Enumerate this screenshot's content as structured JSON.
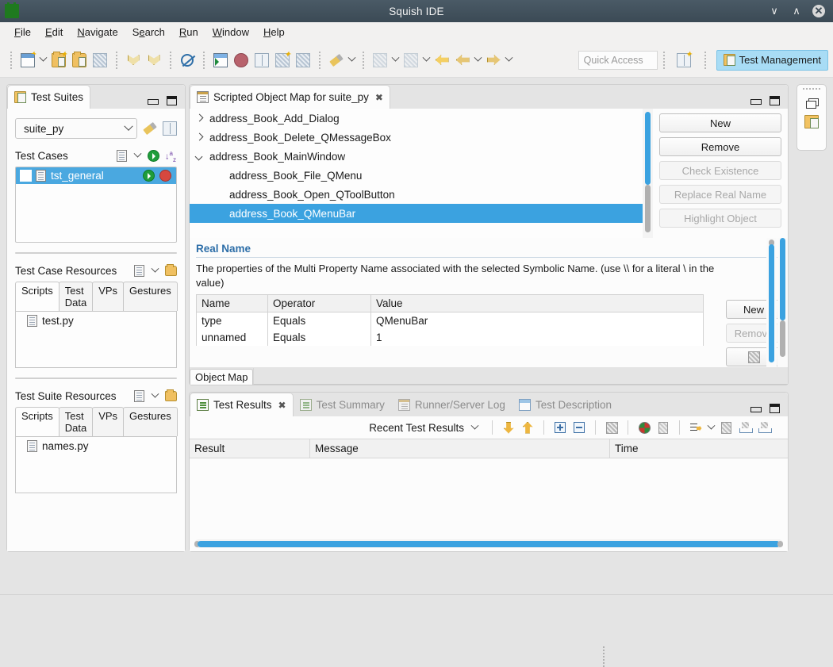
{
  "window": {
    "title": "Squish IDE",
    "logo_icon": "squish-logo-icon",
    "minimize_label": "∨",
    "maximize_label": "∧",
    "close_label": "✕"
  },
  "menubar": {
    "items": [
      {
        "label": "File",
        "mnemonic": "F"
      },
      {
        "label": "Edit",
        "mnemonic": "E"
      },
      {
        "label": "Navigate",
        "mnemonic": "N"
      },
      {
        "label": "Search",
        "mnemonic": "e"
      },
      {
        "label": "Run",
        "mnemonic": "R"
      },
      {
        "label": "Window",
        "mnemonic": "W"
      },
      {
        "label": "Help",
        "mnemonic": "H"
      }
    ]
  },
  "toolbar": {
    "quick_access_placeholder": "Quick Access",
    "groups": [
      {
        "buttons": [
          {
            "icon": "new-document-icon",
            "has_caret": true
          },
          {
            "icon": "new-test-suite-icon"
          },
          {
            "icon": "open-test-suite-icon"
          },
          {
            "icon": "new-test-case-icon"
          }
        ]
      },
      {
        "buttons": [
          {
            "icon": "record-chevron-left-icon"
          },
          {
            "icon": "record-chevron-right-icon"
          }
        ]
      },
      {
        "buttons": [
          {
            "icon": "disable-breakpoints-icon"
          }
        ]
      },
      {
        "buttons": [
          {
            "icon": "run-test-suite-icon"
          },
          {
            "icon": "stop-icon"
          },
          {
            "icon": "spy-columns-icon"
          },
          {
            "icon": "new-verification-point-icon"
          },
          {
            "icon": "object-map-icon"
          }
        ]
      },
      {
        "buttons": [
          {
            "icon": "pencil-marker-icon",
            "has_caret": true
          }
        ]
      },
      {
        "buttons": [
          {
            "icon": "debug-icon",
            "has_caret": true
          },
          {
            "icon": "run-icon",
            "has_caret": true
          },
          {
            "icon": "back-history-icon"
          },
          {
            "icon": "back-arrow-icon",
            "has_caret": true
          },
          {
            "icon": "forward-arrow-icon",
            "has_caret": true
          }
        ]
      }
    ],
    "perspective": {
      "open_perspective_icon": "open-perspective-icon",
      "active": {
        "label": "Test Management",
        "icon": "test-management-icon"
      }
    }
  },
  "test_suites_view": {
    "tab": {
      "label": "Test Suites",
      "icon": "test-suites-icon"
    },
    "minimize_icon": "minimize-icon",
    "maximize_icon": "maximize-icon",
    "suite_combo": {
      "value": "suite_py",
      "caret_icon": "chevron-down-icon"
    },
    "suite_actions": [
      {
        "icon": "edit-suite-settings-icon"
      },
      {
        "icon": "suite-columns-icon"
      }
    ],
    "test_cases": {
      "label": "Test Cases",
      "actions": [
        {
          "icon": "new-test-case-icon"
        },
        {
          "icon": "chevron-down-icon"
        },
        {
          "icon": "run-all-icon"
        },
        {
          "icon": "sort-az-icon"
        }
      ],
      "rows": [
        {
          "name": "tst_general",
          "selected": true,
          "checkbox_icon": "checkbox-unchecked-icon",
          "file_icon": "test-case-icon",
          "run_icon": "run-icon",
          "stop_icon": "stop-icon"
        }
      ]
    },
    "test_case_resources": {
      "label": "Test Case Resources",
      "actions": [
        {
          "icon": "new-file-icon"
        },
        {
          "icon": "chevron-down-icon"
        },
        {
          "icon": "new-folder-icon"
        }
      ],
      "tabs": [
        "Scripts",
        "Test Data",
        "VPs",
        "Gestures"
      ],
      "active_tab": "Scripts",
      "files": [
        {
          "name": "test.py",
          "icon": "python-file-icon"
        }
      ]
    },
    "test_suite_resources": {
      "label": "Test Suite Resources",
      "actions": [
        {
          "icon": "new-file-icon"
        },
        {
          "icon": "chevron-down-icon"
        },
        {
          "icon": "new-folder-icon"
        }
      ],
      "tabs": [
        "Scripts",
        "Test Data",
        "VPs",
        "Gestures"
      ],
      "active_tab": "Scripts",
      "files": [
        {
          "name": "names.py",
          "icon": "python-file-icon"
        }
      ]
    }
  },
  "object_map_editor": {
    "tab": {
      "label": "Scripted Object Map for suite_py",
      "icon": "object-map-icon",
      "close_icon": "close-icon"
    },
    "minimize_icon": "minimize-icon",
    "maximize_icon": "maximize-icon",
    "tree": [
      {
        "label": "address_Book_Add_Dialog",
        "state": "collapsed",
        "depth": 0,
        "selected": false
      },
      {
        "label": "address_Book_Delete_QMessageBox",
        "state": "collapsed",
        "depth": 0,
        "selected": false
      },
      {
        "label": "address_Book_MainWindow",
        "state": "expanded",
        "depth": 0,
        "selected": false
      },
      {
        "label": "address_Book_File_QMenu",
        "state": "leaf",
        "depth": 1,
        "selected": false
      },
      {
        "label": "address_Book_Open_QToolButton",
        "state": "leaf",
        "depth": 1,
        "selected": false
      },
      {
        "label": "address_Book_QMenuBar",
        "state": "leaf",
        "depth": 1,
        "selected": true
      }
    ],
    "buttons": [
      {
        "label": "New",
        "enabled": true
      },
      {
        "label": "Remove",
        "enabled": true
      },
      {
        "label": "Check Existence",
        "enabled": false
      },
      {
        "label": "Replace Real Name",
        "enabled": false
      },
      {
        "label": "Highlight Object",
        "enabled": false
      }
    ],
    "real_name": {
      "title": "Real Name",
      "description": "The properties of the Multi Property Name associated with the selected Symbolic Name. (use \\\\ for a literal \\ in the value)",
      "columns": [
        "Name",
        "Operator",
        "Value"
      ],
      "rows": [
        [
          "type",
          "Equals",
          "QMenuBar"
        ],
        [
          "unnamed",
          "Equals",
          "1"
        ]
      ],
      "side_buttons": [
        {
          "label": "New",
          "enabled": true
        },
        {
          "label": "Remove",
          "enabled": false
        },
        {
          "label": "",
          "enabled": true,
          "icon": "grid-icon"
        }
      ]
    },
    "bottom_tab": "Object Map"
  },
  "test_results_view": {
    "tabs": [
      {
        "label": "Test Results",
        "icon": "test-results-icon",
        "active": true,
        "close_icon": "close-icon"
      },
      {
        "label": "Test Summary",
        "icon": "test-summary-icon",
        "active": false
      },
      {
        "label": "Runner/Server Log",
        "icon": "runner-log-icon",
        "active": false
      },
      {
        "label": "Test Description",
        "icon": "test-description-icon",
        "active": false
      }
    ],
    "minimize_icon": "minimize-icon",
    "maximize_icon": "maximize-icon",
    "toolbar": {
      "filter_label": "Recent Test Results",
      "filter_caret_icon": "chevron-down-icon",
      "buttons": [
        {
          "icon": "next-result-icon"
        },
        {
          "icon": "previous-result-icon"
        },
        {
          "icon": "expand-all-icon"
        },
        {
          "icon": "collapse-all-icon"
        },
        {
          "icon": "clear-results-icon"
        },
        {
          "icon": "show-failures-icon"
        },
        {
          "icon": "delete-results-icon"
        },
        {
          "icon": "filter-icon",
          "has_caret": true
        },
        {
          "icon": "copy-results-icon"
        },
        {
          "icon": "export-results-icon"
        },
        {
          "icon": "import-results-icon"
        }
      ]
    },
    "columns": [
      "Result",
      "Message",
      "Time"
    ],
    "rows": []
  },
  "fast_view_bar": {
    "grip_icon": "grip-icon",
    "items": [
      {
        "icon": "restore-icon"
      },
      {
        "icon": "test-suites-icon"
      }
    ]
  }
}
